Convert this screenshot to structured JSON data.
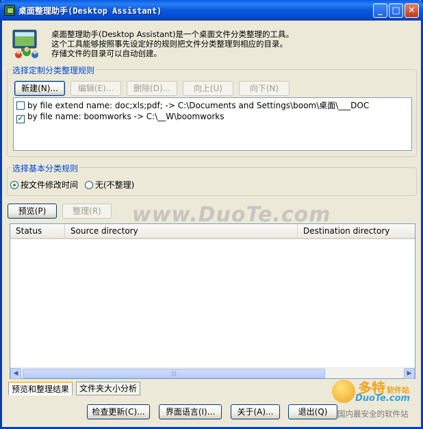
{
  "window": {
    "title": "桌面整理助手(Desktop Assistant)",
    "controls": {
      "minimize": "_",
      "maximize": "□",
      "close": "✕"
    }
  },
  "header": {
    "icon": "computer-users-icon",
    "description_lines": [
      "桌面整理助手(Desktop Assistant)是一个桌面文件分类整理的工具。",
      "这个工具能够按照事先设定好的规则把文件分类整理到相应的目录。",
      "存储文件的目录可以自动创建。"
    ]
  },
  "custom_rules": {
    "legend": "选择定制分类整理规则",
    "buttons": {
      "new": "新建(N)...",
      "edit": "编辑(E)...",
      "delete": "删除(D)...",
      "up": "向上(U)",
      "down": "向下(N)"
    },
    "rules": [
      {
        "checked": false,
        "text": "by file extend name: doc;xls;pdf; -> C:\\Documents and Settings\\boom\\桌面\\___DOC"
      },
      {
        "checked": true,
        "text": "by file name: boomworks -> C:\\__W\\boomworks"
      }
    ]
  },
  "basic_rules": {
    "legend": "选择基本分类规则",
    "options": [
      {
        "label": "按文件修改时间",
        "selected": true
      },
      {
        "label": "无(不整理)",
        "selected": false
      }
    ]
  },
  "actions": {
    "preview": "预览(P)",
    "organize": "整理(R)"
  },
  "results_table": {
    "columns": [
      "Status",
      "Source directory",
      "Destination directory"
    ],
    "rows": []
  },
  "tabs": [
    {
      "label": "预览和整理结果",
      "active": true
    },
    {
      "label": "文件夹大小分析",
      "active": false
    }
  ],
  "footer_buttons": {
    "check_update": "检查更新(C)...",
    "ui_language": "界面语言(I)...",
    "about": "关于(A)...",
    "exit": "退出(Q)"
  },
  "watermarks": {
    "center": "www.DuoTe.com",
    "logo_line1": "多特",
    "logo_line1_small": "软件站",
    "logo_line2": "DuoTe.com",
    "logo_line3": "国内最安全的软件站"
  },
  "colors": {
    "titlebar": "#0858e0",
    "window_bg": "#ece9d8",
    "legend_text": "#0046d5",
    "check_mark": "#21a121"
  }
}
